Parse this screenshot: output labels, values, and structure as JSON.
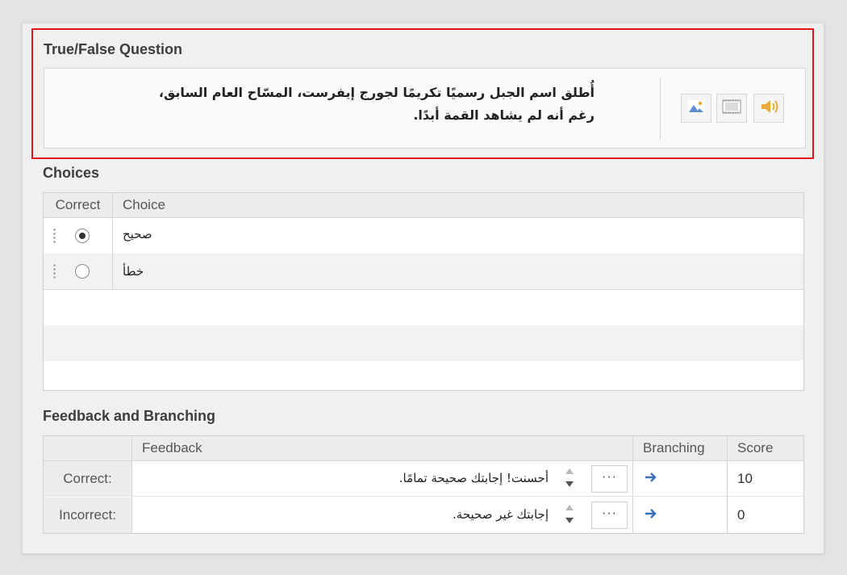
{
  "question": {
    "title": "True/False Question",
    "line1": "أُطلق اسم الجبل رسميًا تكريمًا لجورج إيفرست، المسّاح العام السابق،",
    "line2": "رغم أنه لم يشاهد القمة أبدًا.",
    "media_buttons": [
      "image-icon",
      "video-icon",
      "audio-icon"
    ]
  },
  "choices": {
    "title": "Choices",
    "headers": {
      "correct": "Correct",
      "choice": "Choice"
    },
    "rows": [
      {
        "text": "صحيح",
        "selected": true
      },
      {
        "text": "خطأ",
        "selected": false
      }
    ]
  },
  "feedback": {
    "title": "Feedback and Branching",
    "headers": {
      "feedback": "Feedback",
      "branching": "Branching",
      "score": "Score"
    },
    "rows": [
      {
        "label": "Correct:",
        "text": "أحسنت! إجابتك صحيحة تمامًا.",
        "more": "···",
        "score": "10"
      },
      {
        "label": "Incorrect:",
        "text": "إجابتك غير صحيحة.",
        "more": "···",
        "score": "0"
      }
    ]
  },
  "colors": {
    "highlight": "#e0161e",
    "arrow": "#3d6fb6",
    "media_icon": "#e9a93b"
  }
}
